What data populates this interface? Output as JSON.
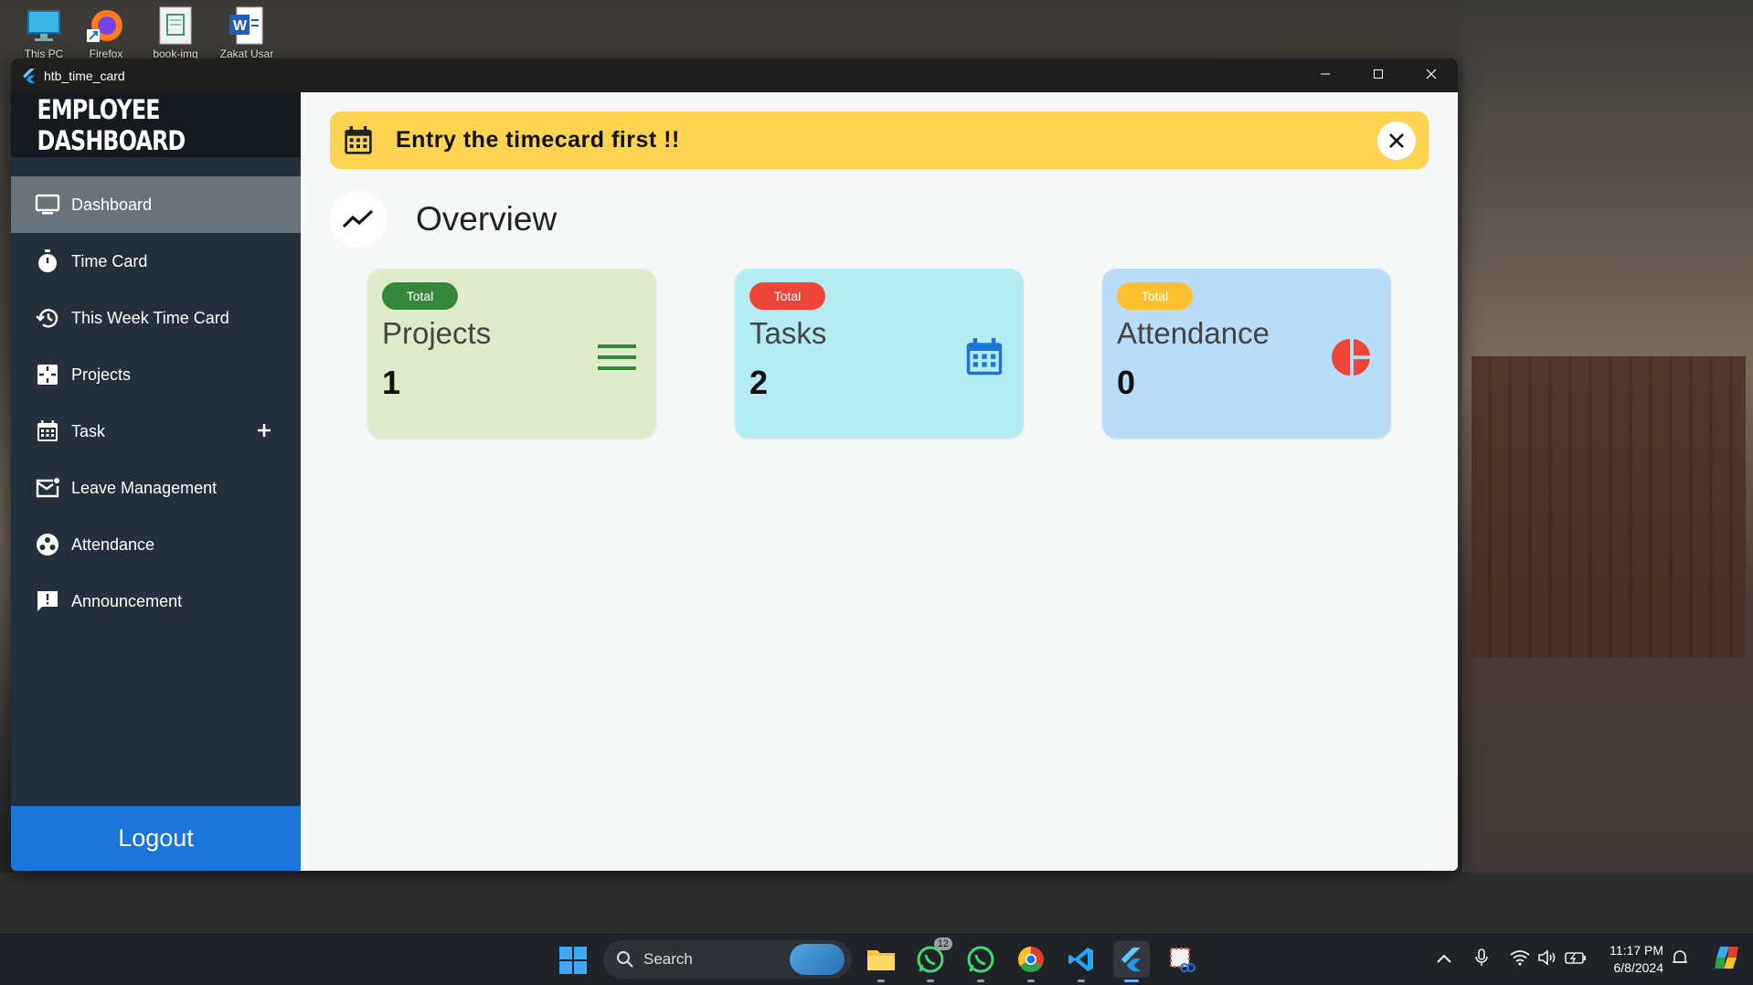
{
  "desktop": {
    "icons": [
      {
        "label": "This PC",
        "icon": "monitor-icon"
      },
      {
        "label": "Firefox",
        "icon": "firefox-icon"
      },
      {
        "label": "book-img",
        "icon": "document-icon"
      },
      {
        "label": "Zakat Usar",
        "icon": "word-document-icon"
      }
    ]
  },
  "window": {
    "title": "htb_time_card",
    "minimize_icon": "minimize-icon",
    "maximize_icon": "maximize-icon",
    "close_icon": "close-icon"
  },
  "sidebar": {
    "brand": "EMPLOYEE DASHBOARD",
    "items": [
      {
        "label": "Dashboard",
        "icon": "monitor-icon",
        "active": true
      },
      {
        "label": "Time Card",
        "icon": "stopwatch-icon"
      },
      {
        "label": "This Week Time Card",
        "icon": "history-icon"
      },
      {
        "label": "Projects",
        "icon": "projects-icon"
      },
      {
        "label": "Task",
        "icon": "calendar-icon",
        "action_icon": "plus-icon"
      },
      {
        "label": "Leave Management",
        "icon": "mail-notification-icon"
      },
      {
        "label": "Attendance",
        "icon": "attendance-icon"
      },
      {
        "label": "Announcement",
        "icon": "announcement-icon"
      }
    ],
    "logout_label": "Logout"
  },
  "banner": {
    "text": "Entry the timecard first !!",
    "icon": "calendar-icon",
    "close_icon": "close-icon",
    "color": "#fdd34f"
  },
  "overview": {
    "title": "Overview",
    "icon": "trending-up-icon"
  },
  "cards": [
    {
      "badge": "Total",
      "title": "Projects",
      "value": "1",
      "icon": "menu-lines-icon",
      "bg": "#dfeccb",
      "badge_color": "#35883a",
      "icon_color": "#35883a"
    },
    {
      "badge": "Total",
      "title": "Tasks",
      "value": "2",
      "icon": "calendar-icon",
      "bg": "#b3ecf1",
      "badge_color": "#ef4538",
      "icon_color": "#1b74d9"
    },
    {
      "badge": "Total",
      "title": "Attendance",
      "value": "0",
      "icon": "pie-chart-icon",
      "bg": "#b9ddf8",
      "badge_color": "#fbc02d",
      "icon_color": "#ef4538"
    }
  ],
  "taskbar": {
    "search_label": "Search",
    "whatsapp_badge": "12",
    "time": "11:17 PM",
    "date": "6/8/2024"
  }
}
